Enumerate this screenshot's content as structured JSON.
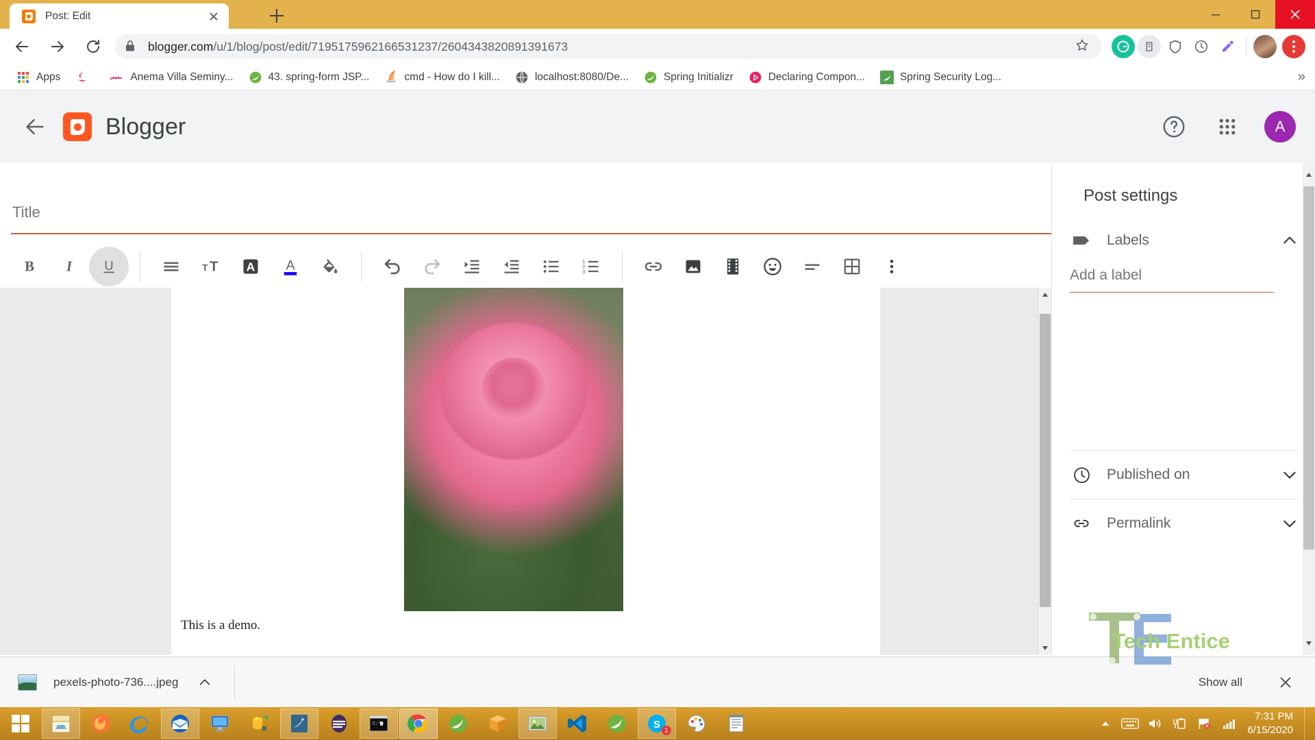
{
  "browser": {
    "tab": {
      "title": "Post: Edit",
      "favicon": "blogger-favicon",
      "close": "×"
    },
    "new_tab_label": "+",
    "window_controls": {
      "minimize": "minimize",
      "maximize": "maximize",
      "close": "close"
    },
    "nav": {
      "back": "back-arrow",
      "forward": "forward-arrow",
      "reload": "reload"
    },
    "omnibox": {
      "lock_icon": "lock-icon",
      "url_domain": "blogger.com",
      "url_path": "/u/1/blog/post/edit/7195175962166531237/2604343820891391673",
      "star_icon": "bookmark-star-icon"
    },
    "extensions": [
      {
        "name": "grammarly-extension",
        "letter": "G",
        "color": "#15c39a"
      },
      {
        "name": "extension-2",
        "letter": "",
        "color": "#9aa0a6"
      },
      {
        "name": "adblock-extension",
        "letter": "",
        "color": "#5f6368"
      },
      {
        "name": "clock-extension",
        "letter": "",
        "color": "#5f6368"
      },
      {
        "name": "colorpicker-extension",
        "letter": "",
        "color": "#7b6cf6"
      }
    ],
    "profile_avatar": "user-avatar",
    "chrome_menu": "three-dot-menu",
    "bookmarks": [
      {
        "label": "Apps",
        "icon": "apps-grid-icon"
      },
      {
        "label": "",
        "icon": "java-icon"
      },
      {
        "label": "Anema Villa Seminy...",
        "icon": "script-logo-icon"
      },
      {
        "label": "43. spring-form JSP...",
        "icon": "spring-leaf-icon"
      },
      {
        "label": "cmd - How do I kill...",
        "icon": "stackoverflow-icon"
      },
      {
        "label": "localhost:8080/De...",
        "icon": "globe-icon"
      },
      {
        "label": "Spring Initializr",
        "icon": "spring-leaf-icon"
      },
      {
        "label": "Declaring Compon...",
        "icon": "play-circle-icon"
      },
      {
        "label": "Spring Security Log...",
        "icon": "spring-square-icon"
      }
    ],
    "bookmarks_overflow": "»"
  },
  "app": {
    "name": "Blogger",
    "logo": "blogger-logo",
    "back": "back-arrow",
    "help_icon": "help-circle-icon",
    "apps_icon": "google-apps-grid-icon",
    "avatar_letter": "A"
  },
  "editor": {
    "title_placeholder": "Title",
    "title_value": "",
    "top_actions": [
      {
        "name": "html-view-button",
        "icon": "code-brackets-icon"
      },
      {
        "name": "save-button",
        "icon": "floppy-disk-icon"
      },
      {
        "name": "preview-button",
        "icon": "eye-icon"
      },
      {
        "name": "publish-button",
        "icon": "send-paper-plane-icon"
      }
    ],
    "toolbar": [
      {
        "name": "bold-button",
        "icon": "bold-icon",
        "label": "B",
        "active": false
      },
      {
        "name": "italic-button",
        "icon": "italic-icon",
        "label": "I",
        "active": false
      },
      {
        "name": "underline-button",
        "icon": "underline-icon",
        "label": "U",
        "active": true
      },
      {
        "sep": true
      },
      {
        "name": "paragraph-style-button",
        "icon": "paragraph-lines-icon",
        "active": false
      },
      {
        "name": "font-size-button",
        "icon": "font-size-icon",
        "active": false
      },
      {
        "name": "text-background-color-button",
        "icon": "text-highlight-icon",
        "active": false
      },
      {
        "name": "text-color-button",
        "icon": "text-color-icon",
        "active": false
      },
      {
        "name": "fill-color-button",
        "icon": "paint-bucket-icon",
        "active": false
      },
      {
        "sep": true
      },
      {
        "name": "undo-button",
        "icon": "undo-arrow-icon",
        "active": false
      },
      {
        "name": "redo-button",
        "icon": "redo-arrow-icon",
        "active": false
      },
      {
        "name": "increase-indent-button",
        "icon": "indent-increase-icon",
        "active": false
      },
      {
        "name": "decrease-indent-button",
        "icon": "indent-decrease-icon",
        "active": false
      },
      {
        "name": "bulleted-list-button",
        "icon": "bullet-list-icon",
        "active": false
      },
      {
        "name": "numbered-list-button",
        "icon": "numbered-list-icon",
        "active": false
      },
      {
        "sep": true
      },
      {
        "name": "insert-link-button",
        "icon": "link-chain-icon",
        "active": false
      },
      {
        "name": "insert-image-button",
        "icon": "image-icon",
        "active": false
      },
      {
        "name": "insert-video-button",
        "icon": "film-strip-icon",
        "active": false
      },
      {
        "name": "insert-emoji-button",
        "icon": "smiley-face-icon",
        "active": false
      },
      {
        "name": "insert-jump-break-button",
        "icon": "jump-break-icon",
        "active": false
      },
      {
        "name": "insert-table-button",
        "icon": "table-grid-icon",
        "active": false
      },
      {
        "name": "more-options-button",
        "icon": "vertical-three-dots-icon",
        "active": false
      }
    ],
    "body_text": "This is a demo.",
    "image_alt": "pink-rose-photo"
  },
  "settings": {
    "heading": "Post settings",
    "labels": {
      "title": "Labels",
      "icon": "label-tag-icon",
      "chevron": "chevron-up-icon",
      "input_placeholder": "Add a label",
      "input_value": ""
    },
    "rows": [
      {
        "label": "Published on",
        "icon": "clock-icon",
        "chevron": "chevron-down-icon"
      },
      {
        "label": "Permalink",
        "icon": "link-chain-icon",
        "chevron": "chevron-down-icon"
      }
    ]
  },
  "download_shelf": {
    "file_name": "pexels-photo-736....jpeg",
    "file_icon": "image-thumbnail-icon",
    "caret": "chevron-up-icon",
    "show_all": "Show all",
    "close": "×"
  },
  "watermark": {
    "text": "Tech Entice"
  },
  "taskbar": {
    "start": "windows-start-icon",
    "items": [
      {
        "name": "file-explorer",
        "icon": "folder-icon",
        "state": "open"
      },
      {
        "name": "firefox",
        "icon": "firefox-icon",
        "state": "idle"
      },
      {
        "name": "internet-explorer",
        "icon": "ie-icon",
        "state": "idle"
      },
      {
        "name": "thunderbird",
        "icon": "thunderbird-icon",
        "state": "open"
      },
      {
        "name": "remote-desktop",
        "icon": "monitor-icon",
        "state": "idle"
      },
      {
        "name": "database-tool",
        "icon": "toad-icon",
        "state": "idle"
      },
      {
        "name": "mysql-workbench",
        "icon": "dolphin-icon",
        "state": "open"
      },
      {
        "name": "eclipse",
        "icon": "eclipse-icon",
        "state": "idle"
      },
      {
        "name": "command-prompt",
        "icon": "cmd-icon",
        "state": "open"
      },
      {
        "name": "google-chrome",
        "icon": "chrome-icon",
        "state": "active"
      },
      {
        "name": "spring-tool-suite",
        "icon": "spring-icon",
        "state": "idle"
      },
      {
        "name": "package-app",
        "icon": "box-icon",
        "state": "idle"
      },
      {
        "name": "photos-app",
        "icon": "photo-icon",
        "state": "open"
      },
      {
        "name": "vs-code",
        "icon": "vscode-icon",
        "state": "idle"
      },
      {
        "name": "spring-tools",
        "icon": "leaf-icon",
        "state": "idle"
      },
      {
        "name": "skype",
        "icon": "skype-icon",
        "state": "open",
        "badge": "1"
      },
      {
        "name": "paint",
        "icon": "paint-palette-icon",
        "state": "idle"
      },
      {
        "name": "notes-app",
        "icon": "notepad-icon",
        "state": "idle"
      }
    ],
    "tray": [
      {
        "name": "show-hidden-icons",
        "icon": "chevron-up-icon"
      },
      {
        "name": "keyboard-layout",
        "icon": "keyboard-icon"
      },
      {
        "name": "volume",
        "icon": "speaker-icon"
      },
      {
        "name": "battery",
        "icon": "battery-icon"
      },
      {
        "name": "action-center",
        "icon": "flag-icon"
      },
      {
        "name": "network",
        "icon": "signal-bars-icon"
      }
    ],
    "clock": {
      "time": "7:31 PM",
      "date": "6/15/2020"
    }
  }
}
